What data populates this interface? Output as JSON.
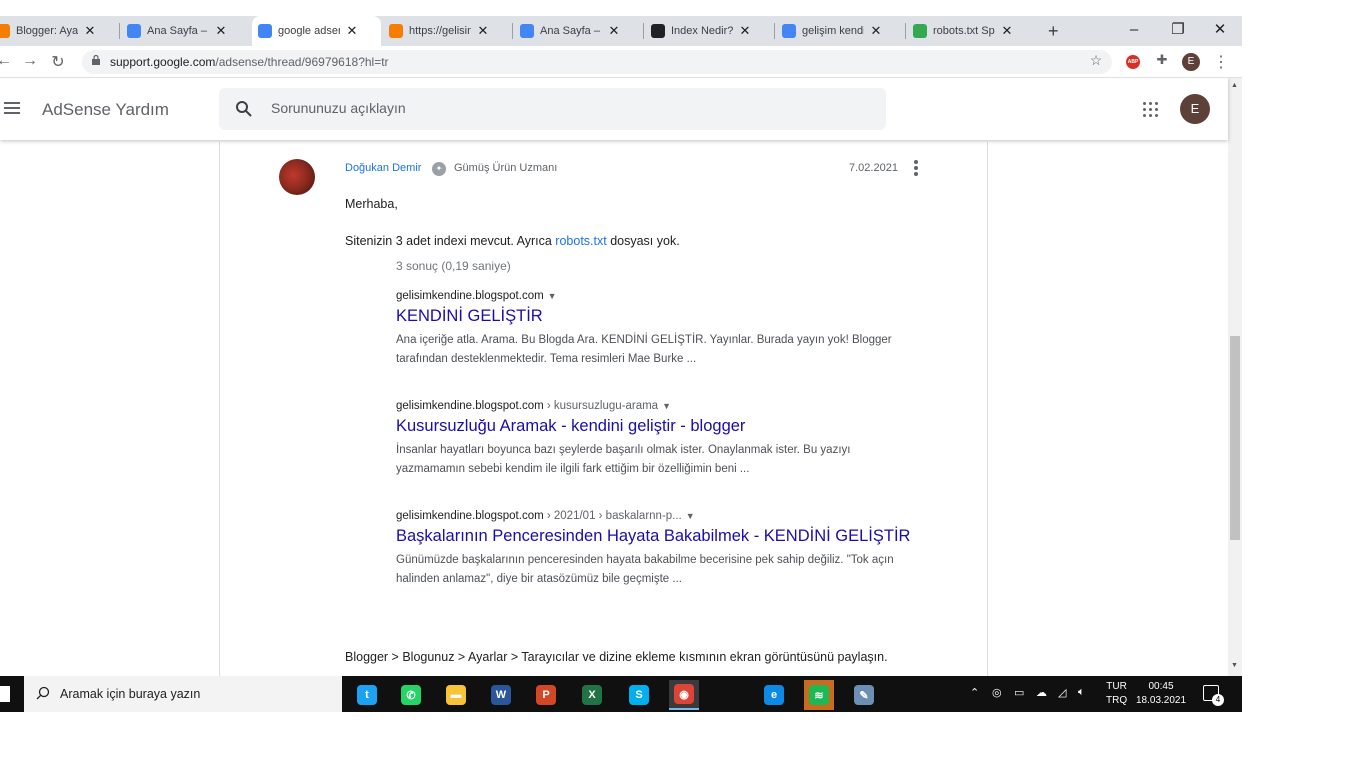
{
  "browser": {
    "tabs": [
      {
        "label": "Blogger: Ayarl",
        "icon": "blogger-icon",
        "color": "#f57d00"
      },
      {
        "label": "Ana Sayfa – Go",
        "icon": "adsense-icon",
        "color": "#4285f4"
      },
      {
        "label": "google adsens",
        "icon": "google-icon",
        "color": "#4285f4",
        "active": true
      },
      {
        "label": "https://gelisim",
        "icon": "blogger-icon",
        "color": "#f57d00"
      },
      {
        "label": "Ana Sayfa – Go",
        "icon": "adsense-icon",
        "color": "#4285f4"
      },
      {
        "label": "Index Nedir? -",
        "icon": "page-icon",
        "color": "#202124"
      },
      {
        "label": "gelişim kendin",
        "icon": "google-icon",
        "color": "#4285f4"
      },
      {
        "label": "robots.txt Spe",
        "icon": "code-icon",
        "color": "#34a853"
      }
    ],
    "close_glyph": "✕",
    "new_tab_glyph": "+",
    "url_host": "support.google.com",
    "url_path": "/adsense/thread/96979618?hl=tr",
    "profile_initial": "E",
    "extension_label": "ABP"
  },
  "appbar": {
    "title": "AdSense Yardım",
    "search_placeholder": "Sorununuzu açıklayın",
    "account_initial": "E"
  },
  "post": {
    "author": "Doğukan Demir",
    "badge": "Gümüş Ürün Uzmanı",
    "date": "7.02.2021",
    "greeting": "Merhaba,",
    "line1_before": "Sitenizin 3 adet indexi mevcut. Ayrıca ",
    "line1_link": "robots.txt",
    "line1_after": " dosyası yok.",
    "stats": "3 sonuç (0,19 saniye)",
    "results": [
      {
        "url": "gelisimkendine.blogspot.com",
        "crumb": "",
        "title": "KENDİNİ GELİŞTİR",
        "snippet": "Ana içeriğe atla. Arama. Bu Blogda Ara. KENDİNİ GELİŞTİR. Yayınlar. Burada yayın yok! Blogger tarafından desteklenmektedir. Tema resimleri Mae Burke ..."
      },
      {
        "url": "gelisimkendine.blogspot.com",
        "crumb": " › kusursuzlugu-arama",
        "title": "Kusursuzluğu Aramak - kendini geliştir - blogger",
        "snippet": "İnsanlar hayatları boyunca bazı şeylerde başarılı olmak ister. Onaylanmak ister. Bu yazıyı yazmamamın sebebi kendim ile ilgili fark ettiğim bir özelliğimin beni ..."
      },
      {
        "url": "gelisimkendine.blogspot.com",
        "crumb": " › 2021/01 › baskalarnn-p...",
        "title": "Başkalarının Penceresinden Hayata Bakabilmek - KENDİNİ GELİŞTİR",
        "snippet": "Günümüzde başkalarının penceresinden hayata bakabilme becerisine pek sahip değiliz. \"Tok açın halinden anlamaz\", diye bir atasözümüz bile geçmişte ..."
      }
    ],
    "closing": "Blogger > Blogunuz > Ayarlar > Tarayıcılar ve dizine ekleme kısmının ekran görüntüsünü paylaşın."
  },
  "taskbar": {
    "search_label": "Aramak için buraya yazın",
    "apps": [
      {
        "name": "twitter",
        "glyph": "t",
        "color": "#1da1f2"
      },
      {
        "name": "whatsapp",
        "glyph": "✆",
        "color": "#25d366"
      },
      {
        "name": "file-explorer",
        "glyph": "▬",
        "color": "#f8c338"
      },
      {
        "name": "word",
        "glyph": "W",
        "color": "#2b579a"
      },
      {
        "name": "powerpoint",
        "glyph": "P",
        "color": "#d24726"
      },
      {
        "name": "excel",
        "glyph": "X",
        "color": "#217346"
      },
      {
        "name": "skype",
        "glyph": "S",
        "color": "#00aff0"
      },
      {
        "name": "chrome",
        "glyph": "◉",
        "color": "#db4437",
        "active": true
      },
      {
        "name": "edge",
        "glyph": "e",
        "color": "#0c8ae6"
      },
      {
        "name": "spotify",
        "glyph": "≋",
        "color": "#1db954"
      },
      {
        "name": "paint",
        "glyph": "✎",
        "color": "#6d8fb3"
      }
    ],
    "lang_top": "TUR",
    "lang_bottom": "TRQ",
    "time": "00:45",
    "date": "18.03.2021",
    "notification_count": "4"
  }
}
